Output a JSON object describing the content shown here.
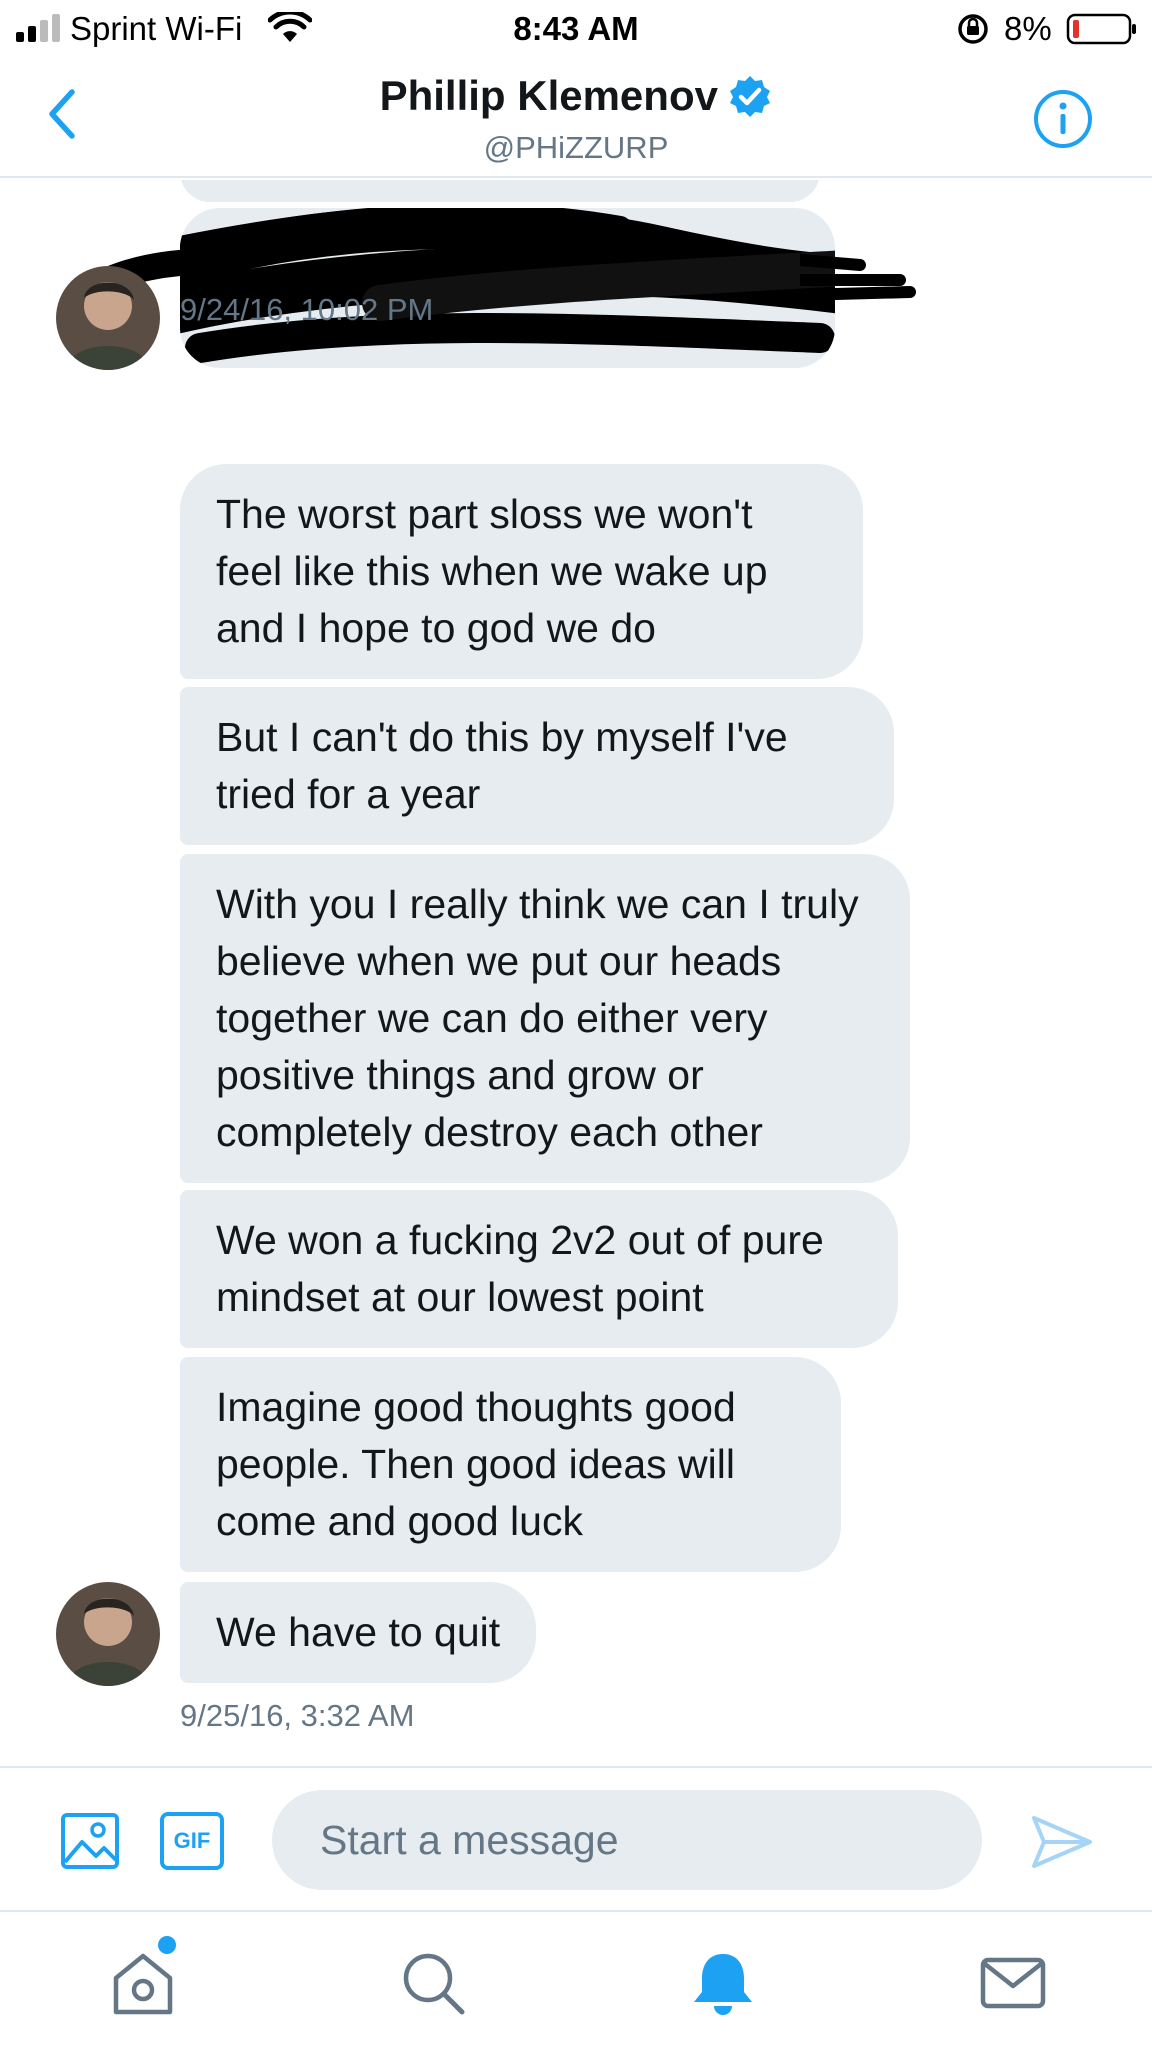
{
  "status_bar": {
    "carrier": "Sprint Wi-Fi",
    "time": "8:43 AM",
    "battery_percent": "8%"
  },
  "header": {
    "name": "Phillip Klemenov",
    "handle": "@PHiZZURP",
    "verified": true
  },
  "conversation": {
    "redacted_message": "[redacted]",
    "timestamps": [
      "9/24/16, 10:02 PM",
      "9/25/16, 3:32 AM"
    ],
    "messages": [
      "The worst part sloss we won't feel like this when we wake up and I hope to god we do",
      "But I can't do this by myself I've tried for a year",
      "With you I really think we can I truly believe when we put our heads together we can do either very positive things and grow or completely destroy each other",
      "We won a fucking 2v2 out of pure mindset at our lowest point",
      "Imagine good thoughts good people. Then good ideas will come and good luck",
      "We have to quit"
    ]
  },
  "composer": {
    "placeholder": "Start a message",
    "gif_label": "GIF"
  },
  "tab_bar": {
    "icons": [
      "home-icon",
      "search-icon",
      "notifications-icon",
      "messages-icon"
    ],
    "home_has_badge": true
  },
  "colors": {
    "accent": "#1da1f2",
    "bubble": "#e6ecf0",
    "secondary_text": "#657786"
  }
}
